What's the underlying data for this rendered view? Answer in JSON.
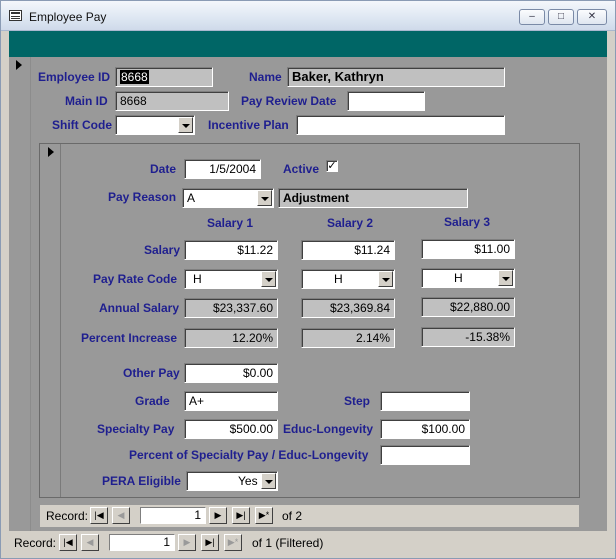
{
  "window": {
    "title": "Employee Pay",
    "controls": {
      "minimize": "–",
      "maximize": "□",
      "close": "✕"
    }
  },
  "main": {
    "employee_id_label": "Employee ID",
    "employee_id": "8668",
    "name_label": "Name",
    "name": "Baker, Kathryn",
    "main_id_label": "Main ID",
    "main_id": "8668",
    "pay_review_date_label": "Pay Review Date",
    "pay_review_date": "",
    "shift_code_label": "Shift Code",
    "shift_code": "",
    "incentive_plan_label": "Incentive Plan",
    "incentive_plan": ""
  },
  "sub": {
    "date_label": "Date",
    "date": "1/5/2004",
    "active_label": "Active",
    "active_checked": "✓",
    "pay_reason_label": "Pay Reason",
    "pay_reason_code": "A",
    "pay_reason_desc": "Adjustment",
    "salary_headers": [
      "Salary 1",
      "Salary 2",
      "Salary 3"
    ],
    "salary_label": "Salary",
    "salary": [
      "$11.22",
      "$11.24",
      "$11.00"
    ],
    "pay_rate_code_label": "Pay Rate Code",
    "pay_rate_code": [
      "H",
      "H",
      "H"
    ],
    "annual_salary_label": "Annual Salary",
    "annual_salary": [
      "$23,337.60",
      "$23,369.84",
      "$22,880.00"
    ],
    "percent_increase_label": "Percent Increase",
    "percent_increase": [
      "12.20%",
      "2.14%",
      "-15.38%"
    ],
    "other_pay_label": "Other Pay",
    "other_pay": "$0.00",
    "grade_label": "Grade",
    "grade": "A+",
    "step_label": "Step",
    "step": "",
    "specialty_pay_label": "Specialty Pay",
    "specialty_pay": "$500.00",
    "educ_longevity_label": "Educ-Longevity",
    "educ_longevity": "$100.00",
    "percent_specialty_label": "Percent of Specialty Pay / Educ-Longevity",
    "percent_specialty": "",
    "pera_eligible_label": "PERA Eligible",
    "pera_eligible": "Yes"
  },
  "sub_nav": {
    "record_label": "Record:",
    "current": "1",
    "of_text": "of  2"
  },
  "main_nav": {
    "record_label": "Record:",
    "current": "1",
    "of_text": "of  1 (Filtered)"
  },
  "icons": {
    "first": "|◀",
    "prev": "◀",
    "next": "▶",
    "last": "▶|",
    "new": "▶*"
  },
  "colors": {
    "header_strip": "#006666",
    "form_background": "#999999",
    "label_text": "#1f1f8f"
  }
}
